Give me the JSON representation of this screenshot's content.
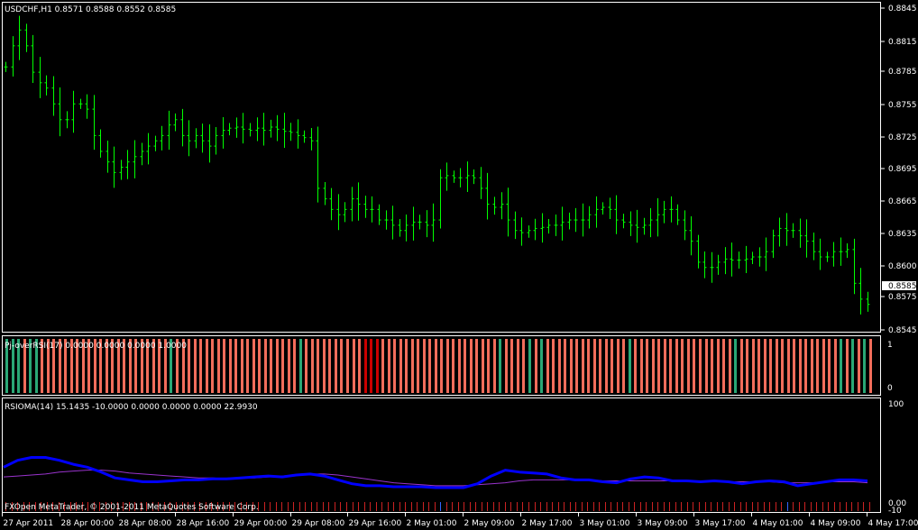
{
  "main_panel": {
    "header": "USDCHF,H1  0.8571 0.8588 0.8552 0.8585",
    "current_price_label": "0.8585",
    "price_ticks": [
      "0.8845",
      "0.8815",
      "0.8785",
      "0.8755",
      "0.8725",
      "0.8695",
      "0.8665",
      "0.8635",
      "0.8600",
      "0.8575",
      "0.8545"
    ],
    "bar_color": "#00ff00"
  },
  "pj_panel": {
    "header": "Pj-overRSI(17) 0.0000 0.0000 0.0000 1.0000",
    "scale_top": "1",
    "scale_bottom": "0",
    "up_color": "#2aa876",
    "down_color": "#f26d5b",
    "strong_color": "#cc0000"
  },
  "rsioma_panel": {
    "header": "RSIOMA(14) 15.1435 -10.0000 0.0000 0.0000 0.0000 22.9930",
    "scale_top": "100",
    "scale_mid": "0.00",
    "scale_bottom": "-10",
    "footer": "FXOpen MetaTrader, © 2001-2011 MetaQuotes Software Corp.",
    "rsi_color": "#0000ff",
    "ma_color": "#9933cc"
  },
  "time_axis": [
    "27 Apr 2011",
    "28 Apr 00:00",
    "28 Apr 08:00",
    "28 Apr 16:00",
    "29 Apr 00:00",
    "29 Apr 08:00",
    "29 Apr 16:00",
    "2 May 01:00",
    "2 May 09:00",
    "2 May 17:00",
    "3 May 01:00",
    "3 May 09:00",
    "3 May 17:00",
    "4 May 01:00",
    "4 May 09:00",
    "4 May 17:00"
  ],
  "chart_data": {
    "type": "ohlc",
    "symbol": "USDCHF",
    "timeframe": "H1",
    "ylim": [
      0.8545,
      0.8855
    ],
    "closes": [
      0.8795,
      0.8815,
      0.883,
      0.8815,
      0.879,
      0.878,
      0.8775,
      0.876,
      0.8745,
      0.8745,
      0.876,
      0.876,
      0.8755,
      0.873,
      0.8715,
      0.8705,
      0.8695,
      0.87,
      0.8705,
      0.871,
      0.8715,
      0.872,
      0.8725,
      0.873,
      0.874,
      0.8745,
      0.873,
      0.8725,
      0.873,
      0.8725,
      0.872,
      0.873,
      0.8735,
      0.8737,
      0.8738,
      0.8736,
      0.8735,
      0.8737,
      0.8735,
      0.8738,
      0.8736,
      0.8734,
      0.8733,
      0.873,
      0.8728,
      0.8725,
      0.868,
      0.867,
      0.866,
      0.8655,
      0.866,
      0.867,
      0.8665,
      0.866,
      0.866,
      0.865,
      0.865,
      0.8645,
      0.864,
      0.8645,
      0.8648,
      0.8648,
      0.8645,
      0.865,
      0.869,
      0.8692,
      0.869,
      0.869,
      0.8692,
      0.869,
      0.868,
      0.8665,
      0.8662,
      0.8665,
      0.865,
      0.864,
      0.8638,
      0.864,
      0.8642,
      0.8643,
      0.8645,
      0.8645,
      0.8648,
      0.865,
      0.865,
      0.865,
      0.8655,
      0.866,
      0.8662,
      0.866,
      0.865,
      0.8648,
      0.8645,
      0.8643,
      0.8645,
      0.865,
      0.8655,
      0.866,
      0.866,
      0.865,
      0.864,
      0.863,
      0.861,
      0.8605,
      0.8605,
      0.861,
      0.8613,
      0.8612,
      0.8612,
      0.8613,
      0.8615,
      0.8615,
      0.862,
      0.8635,
      0.8642,
      0.864,
      0.864,
      0.8635,
      0.863,
      0.862,
      0.8615,
      0.8615,
      0.862,
      0.862,
      0.8622,
      0.859,
      0.8575,
      0.857
    ],
    "pj_overrsi": {
      "up_bar_indices": [
        0,
        1,
        2,
        4,
        5,
        28,
        50,
        84,
        89,
        91,
        106,
        124,
        142,
        144,
        146
      ],
      "strong_bar_indices": [
        61,
        62,
        63
      ]
    },
    "rsioma": {
      "ylim": [
        -10,
        100
      ],
      "rsi": [
        35,
        42,
        45,
        45,
        42,
        38,
        35,
        30,
        24,
        22,
        20,
        20,
        21,
        22,
        22,
        23,
        23,
        24,
        25,
        26,
        25,
        27,
        28,
        26,
        22,
        18,
        16,
        16,
        15,
        15,
        15,
        14,
        14,
        14,
        18,
        26,
        32,
        30,
        29,
        28,
        24,
        22,
        22,
        20,
        19,
        23,
        25,
        24,
        21,
        21,
        20,
        21,
        20,
        18,
        20,
        21,
        20,
        16,
        18,
        20,
        22,
        22,
        21
      ],
      "ma": [
        25,
        26,
        27,
        28,
        30,
        31,
        32,
        32,
        31,
        29,
        28,
        27,
        26,
        25,
        24,
        24,
        23,
        24,
        24,
        25,
        26,
        27,
        28,
        28,
        27,
        25,
        23,
        21,
        19,
        18,
        17,
        16,
        16,
        16,
        17,
        18,
        19,
        21,
        22,
        22,
        22,
        22,
        22,
        21,
        21,
        21,
        21,
        21,
        21,
        21,
        20,
        20,
        20,
        20,
        20,
        20,
        19,
        19,
        19,
        20,
        20,
        20,
        19
      ]
    }
  }
}
